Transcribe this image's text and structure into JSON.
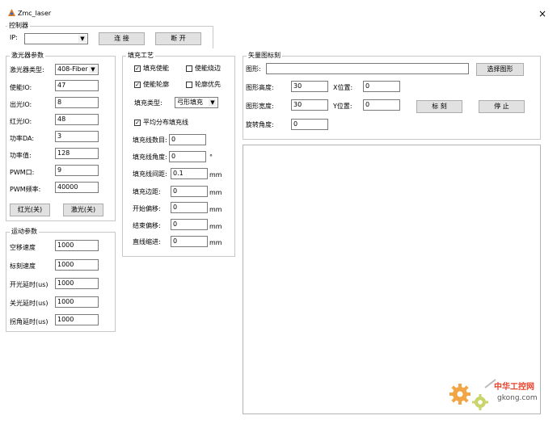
{
  "window": {
    "title": "Zmc_laser",
    "close_glyph": "×"
  },
  "controller": {
    "title": "控制器",
    "ip_label": "IP:",
    "ip_value": "",
    "connect_btn": "连 接",
    "disconnect_btn": "断 开"
  },
  "laser_params": {
    "title": "激光器参数",
    "type_label": "激光器类型:",
    "type_value": "408-Fiber",
    "fields": [
      {
        "label": "使能IO:",
        "value": "47"
      },
      {
        "label": "出光IO:",
        "value": "8"
      },
      {
        "label": "红光IO:",
        "value": "48"
      },
      {
        "label": "功率DA:",
        "value": "3"
      },
      {
        "label": "功率值:",
        "value": "128"
      },
      {
        "label": "PWM口:",
        "value": "9"
      },
      {
        "label": "PWM频率:",
        "value": "40000"
      }
    ],
    "red_btn": "红光(关)",
    "laser_btn": "激光(关)"
  },
  "motion_params": {
    "title": "运动参数",
    "fields": [
      {
        "label": "空移速度",
        "value": "1000"
      },
      {
        "label": "标刻速度",
        "value": "1000"
      },
      {
        "label": "开光延时(us)",
        "value": "1000"
      },
      {
        "label": "关光延时(us)",
        "value": "1000"
      },
      {
        "label": "拐角延时(us)",
        "value": "1000"
      }
    ]
  },
  "fill": {
    "title": "填充工艺",
    "cb_enable_fill": {
      "label": "填充使能",
      "checked": true
    },
    "cb_enable_edge": {
      "label": "使能绕边",
      "checked": false
    },
    "cb_enable_contour": {
      "label": "使能轮廓",
      "checked": true
    },
    "cb_contour_first": {
      "label": "轮廓优先",
      "checked": false
    },
    "type_label": "填充类型:",
    "type_value": "弓形填充",
    "cb_even": {
      "label": "平均分布填充线",
      "checked": true
    },
    "rows": [
      {
        "label": "填充线数目:",
        "value": "0",
        "unit": ""
      },
      {
        "label": "填充线角度:",
        "value": "0",
        "unit": "°"
      },
      {
        "label": "填充线间距:",
        "value": "0.1",
        "unit": "mm"
      },
      {
        "label": "填充边距:",
        "value": "0",
        "unit": "mm"
      },
      {
        "label": "开始偏移:",
        "value": "0",
        "unit": "mm"
      },
      {
        "label": "结束偏移:",
        "value": "0",
        "unit": "mm"
      },
      {
        "label": "直线缩进:",
        "value": "0",
        "unit": "mm"
      }
    ]
  },
  "vector": {
    "title": "矢量图标刻",
    "shape_label": "图形:",
    "shape_value": "",
    "select_btn": "选择图形",
    "height_label": "图形高度:",
    "height_value": "30",
    "width_label": "图形宽度:",
    "width_value": "30",
    "angle_label": "旋转角度:",
    "angle_value": "0",
    "xpos_label": "X位置:",
    "xpos_value": "0",
    "ypos_label": "Y位置:",
    "ypos_value": "0",
    "mark_btn": "标 刻",
    "stop_btn": "停 止"
  },
  "watermark": {
    "name": "中华工控网",
    "domain": "gkong.com"
  }
}
